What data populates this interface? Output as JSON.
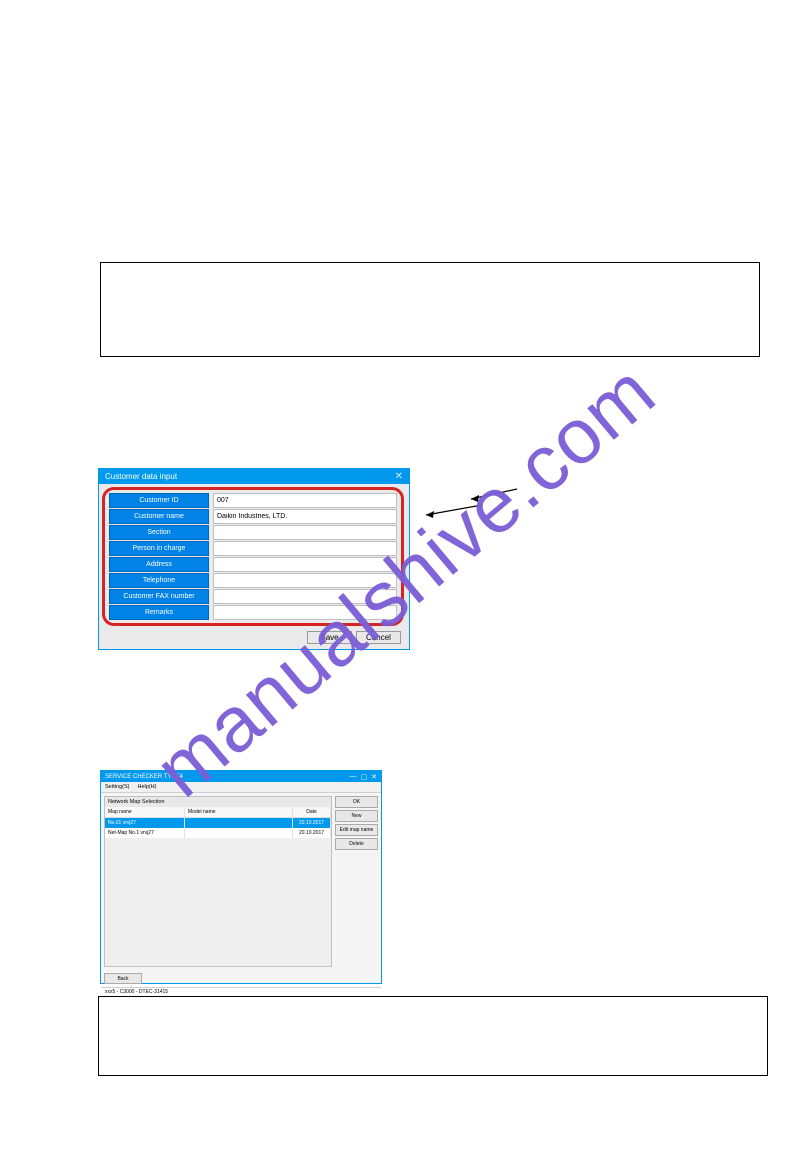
{
  "watermark": "manualshive.com",
  "dialog1": {
    "title": "Customer data input",
    "fields": [
      {
        "label": "Customer ID",
        "value": "007"
      },
      {
        "label": "Customer name",
        "value": "Daikin Industries, LTD."
      },
      {
        "label": "Section",
        "value": ""
      },
      {
        "label": "Person in charge",
        "value": ""
      },
      {
        "label": "Address",
        "value": ""
      },
      {
        "label": "Telephone",
        "value": ""
      },
      {
        "label": "Customer FAX number",
        "value": ""
      },
      {
        "label": "Remarks",
        "value": ""
      }
    ],
    "save": "Save",
    "cancel": "Cancel"
  },
  "dialog2": {
    "title": "SERVICE CHECKER TYPE4",
    "menu": [
      "Setting(S)",
      "Help(H)"
    ],
    "panel": "Network Map Selection",
    "headers": {
      "name": "Map name",
      "model": "Model name",
      "date": "Date"
    },
    "rows": [
      {
        "name": "No.01 vrvj27",
        "model": "",
        "date": "20.10.2017"
      },
      {
        "name": "Net-Map No.1  vrvj27",
        "model": "",
        "date": "20.10.2017"
      }
    ],
    "buttons": [
      "OK",
      "New",
      "Edit map name",
      "Delete"
    ],
    "back": "Back",
    "status": "xxx5 - C3000 - DTEC-31415"
  }
}
